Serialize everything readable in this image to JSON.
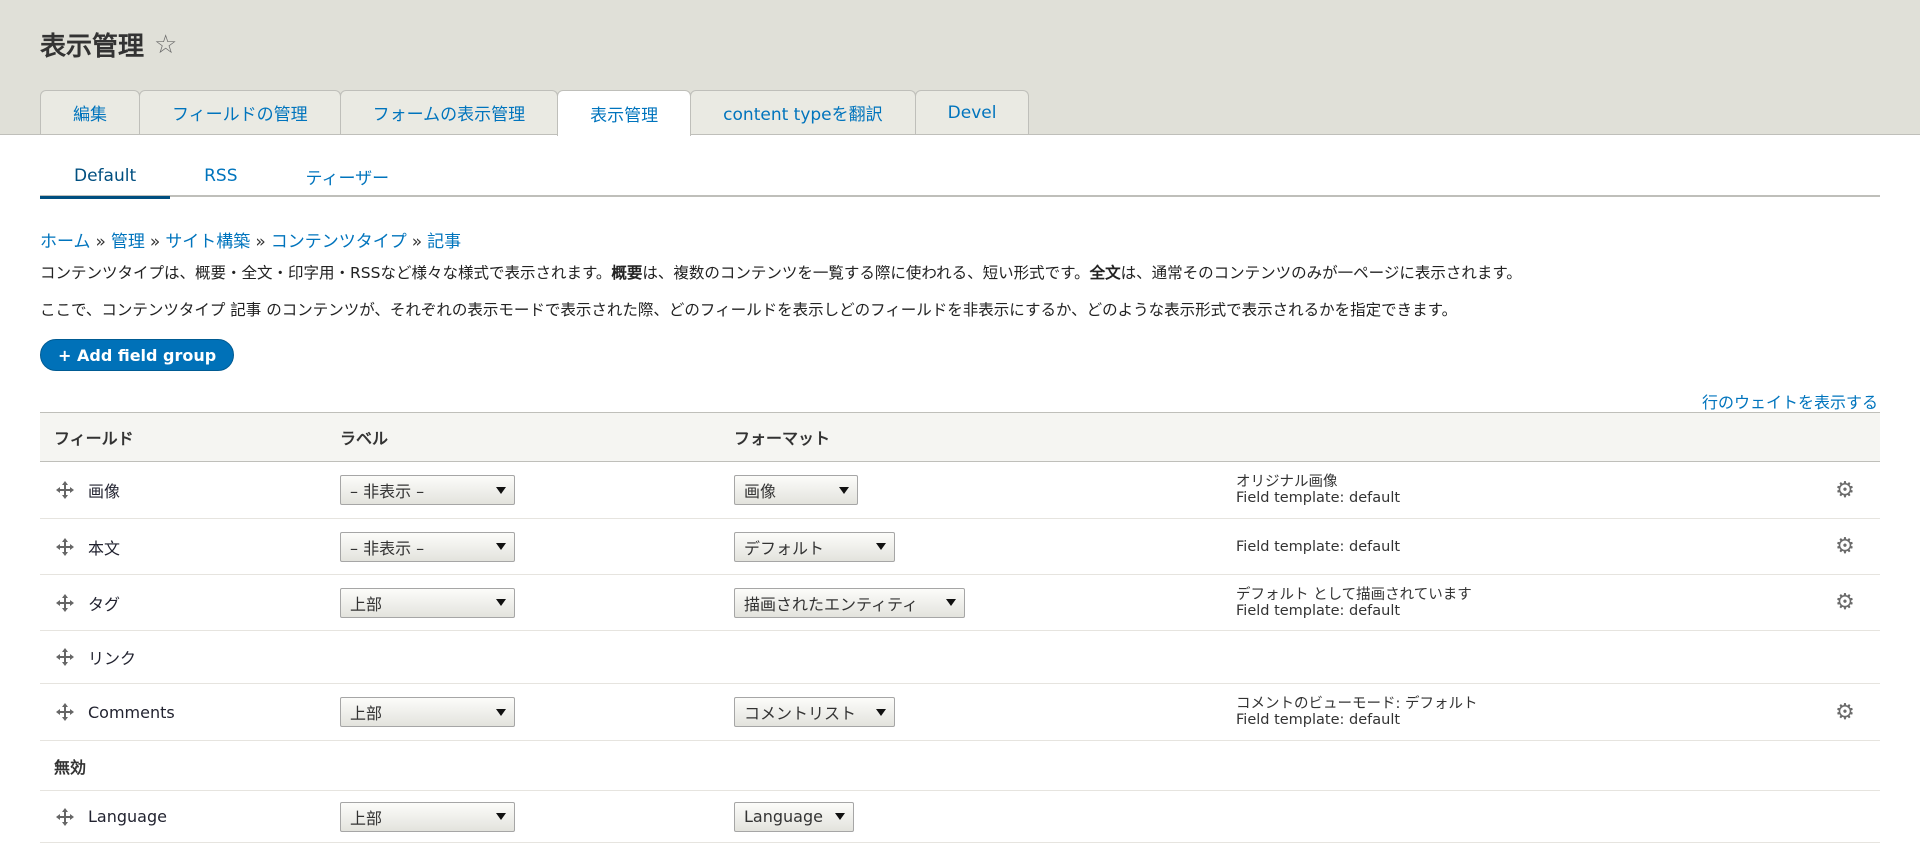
{
  "page": {
    "title": "表示管理"
  },
  "primary_tabs": [
    {
      "label": "編集"
    },
    {
      "label": "フィールドの管理"
    },
    {
      "label": "フォームの表示管理"
    },
    {
      "label": "表示管理"
    },
    {
      "label": "content typeを翻訳"
    },
    {
      "label": "Devel"
    }
  ],
  "secondary_tabs": [
    {
      "label": "Default"
    },
    {
      "label": "RSS"
    },
    {
      "label": "ティーザー"
    }
  ],
  "breadcrumb": [
    "ホーム",
    "管理",
    "サイト構築",
    "コンテンツタイプ",
    "記事"
  ],
  "breadcrumb_sep": "»",
  "description": {
    "line1_a": "コンテンツタイプは、概要・全文・印字用・RSSなど様々な様式で表示されます。",
    "line1_b": "概要",
    "line1_c": "は、複数のコンテンツを一覧する際に使われる、短い形式です。",
    "line1_d": "全文",
    "line1_e": "は、通常そのコンテンツのみが一ページに表示されます。",
    "line2": "ここで、コンテンツタイプ 記事 のコンテンツが、それぞれの表示モードで表示された際、どのフィールドを表示しどのフィールドを非表示にするか、どのような表示形式で表示されるかを指定できます。"
  },
  "add_field_group": "+ Add field group",
  "show_row_weights": "行のウェイトを表示する",
  "table": {
    "headers": {
      "field": "フィールド",
      "label": "ラベル",
      "format": "フォーマット"
    },
    "rows": [
      {
        "field": "画像",
        "label": "– 非表示 –",
        "format": "画像",
        "summary1": "オリジナル画像",
        "summary2": "Field template: default"
      },
      {
        "field": "本文",
        "label": "– 非表示 –",
        "format": "デフォルト",
        "summary1": "",
        "summary2": "Field template: default"
      },
      {
        "field": "タグ",
        "label": "上部",
        "format": "描画されたエンティティ",
        "summary1": "デフォルト として描画されています",
        "summary2": "Field template: default"
      },
      {
        "field": "リンク"
      },
      {
        "field": "Comments",
        "label": "上部",
        "format": "コメントリスト",
        "summary1": "コメントのビューモード: デフォルト",
        "summary2": "Field template: default"
      }
    ],
    "disabled_section": "無効",
    "disabled_rows": [
      {
        "field": "Language",
        "label": "上部",
        "format": "Language"
      }
    ]
  }
}
